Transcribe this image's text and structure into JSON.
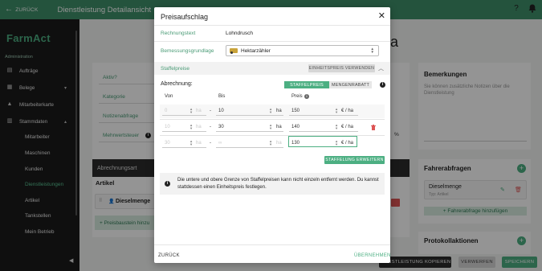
{
  "topbar": {
    "back_label": "ZURÜCK",
    "title": "Dienstleistung Detailansicht",
    "help_icon": "?",
    "bell_icon": "bell-icon"
  },
  "sidebar": {
    "brand": "FarmAct",
    "section": "Administration",
    "items": [
      {
        "label": "Aufträge",
        "icon": "clipboard-icon"
      },
      {
        "label": "Belege",
        "icon": "document-icon"
      },
      {
        "label": "Mitarbeiterkarte",
        "icon": "map-icon"
      },
      {
        "label": "Stammdaten",
        "icon": "chart-icon"
      }
    ],
    "sub_items": [
      "Mitarbeiter",
      "Maschinen",
      "Kunden",
      "Dienstleistungen",
      "Artikel",
      "Tankstellen",
      "Mein Betrieb"
    ]
  },
  "background": {
    "title_fragment": "a",
    "fields": [
      "Aktiv?",
      "Kategorie",
      "Notizenabfrage",
      "Mehrwertsteuer"
    ],
    "mwst_symbol": "%",
    "abrechnungsart": "Abrechnungsart",
    "artikel": "Artikel",
    "artikel_item": "Dieselmenge",
    "preisbaustein": "+ Preisbaustein hinzu",
    "bemerkungen": {
      "title": "Bemerkungen",
      "placeholder": "Sie können zusätzliche Notizen über die Dienstleistung"
    },
    "fahrerabfragen": {
      "title": "Fahrerabfragen",
      "item": "Dieselmenge",
      "item_sub": "Typ: Artikel",
      "add": "+ Fahrerabfrage hinzufügen"
    },
    "protokollaktionen": {
      "title": "Protokollaktionen"
    },
    "buttons": {
      "copy": "DIENSTLEISTUNG KOPIEREN",
      "discard": "VERWERFEN",
      "save": "SPEICHERN"
    }
  },
  "modal": {
    "title": "Preisaufschlag",
    "rechnungstext_label": "Rechnungstext",
    "rechnungstext_value": "Lohndrusch",
    "bemessung_label": "Bemessungsgrundlage",
    "bemessung_value": "Hektarzähler",
    "staffelpreise_label": "Staffelpreise",
    "einheitspreis_btn": "EINHEITSPREIS VERWENDEN",
    "abrechnung_label": "Abrechnung:",
    "toggle_on": "STAFFELPREIS",
    "toggle_off": "MENGENRABATT",
    "col_von": "Von",
    "col_bis": "Bis",
    "col_preis": "Preis",
    "rows": [
      {
        "von": "0",
        "von_unit": "ha",
        "bis": "10",
        "bis_unit": "ha",
        "preis": "150",
        "preis_unit": "€ / ha"
      },
      {
        "von": "10",
        "von_unit": "ha",
        "bis": "30",
        "bis_unit": "ha",
        "preis": "140",
        "preis_unit": "€ / ha"
      },
      {
        "von": "30",
        "von_unit": "ha",
        "bis": "∞",
        "bis_unit": "ha",
        "preis": "130",
        "preis_unit": "€ / ha"
      }
    ],
    "staffelung_btn": "STAFFELUNG ERWEITERN",
    "note": "Die untere und obere Grenze von Staffelpreisen kann nicht einzeln entfernt werden. Du kannst stattdessen einen Einheitspreis festlegen.",
    "back_btn": "ZURÜCK",
    "accept_btn": "ÜBERNEHMEN"
  }
}
